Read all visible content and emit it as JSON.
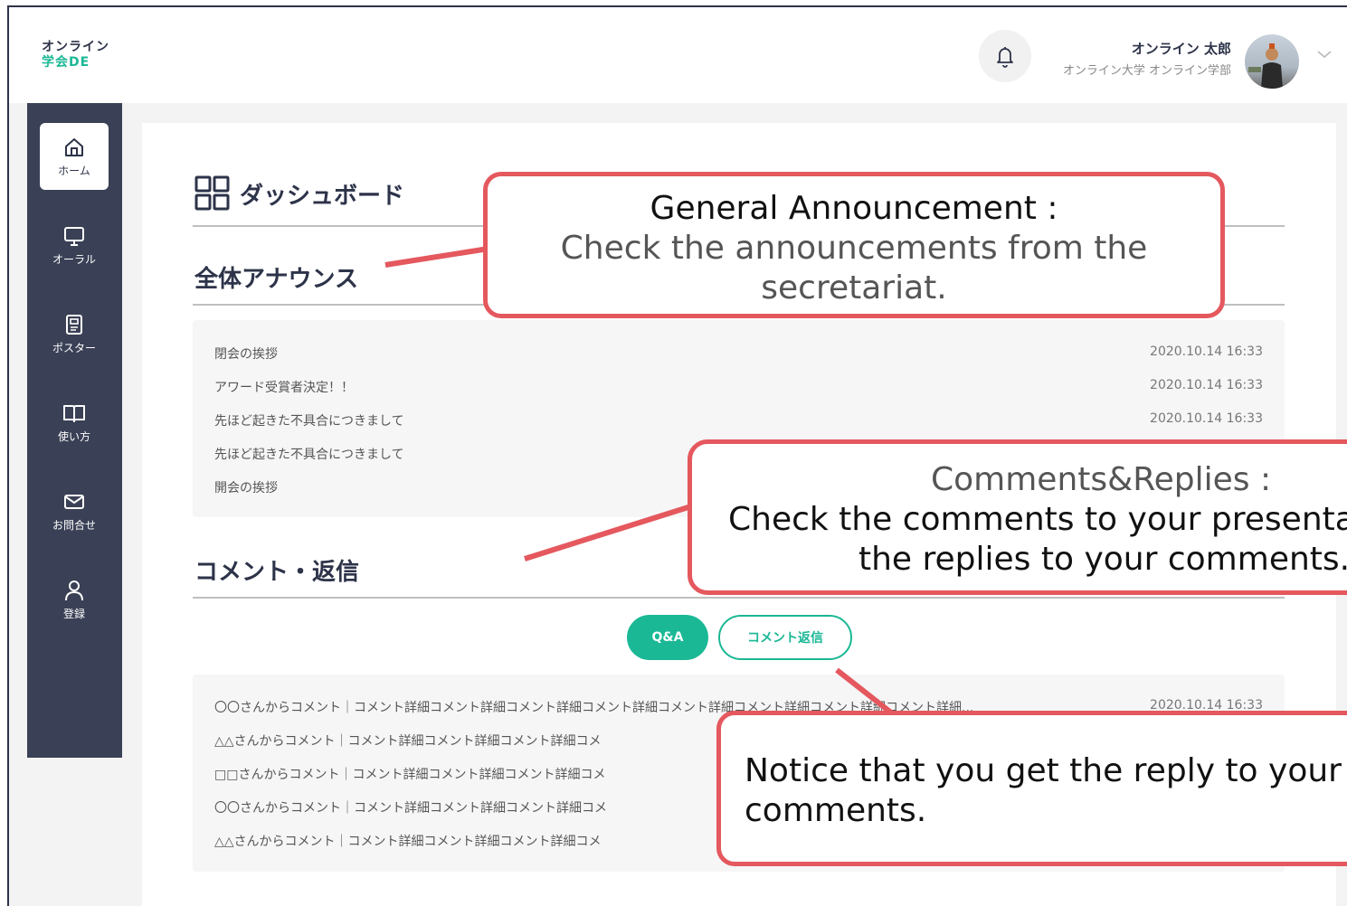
{
  "header": {
    "logo_line1": "オンライン",
    "logo_line2": "学会DE",
    "user_name": "オンライン 太郎",
    "user_org": "オンライン大学 オンライン学部"
  },
  "sidebar": {
    "items": [
      {
        "label": "ホーム",
        "icon": "home-icon",
        "active": true
      },
      {
        "label": "オーラル",
        "icon": "monitor-icon"
      },
      {
        "label": "ポスター",
        "icon": "poster-icon"
      },
      {
        "label": "使い方",
        "icon": "book-icon"
      },
      {
        "label": "お問合せ",
        "icon": "mail-icon"
      },
      {
        "label": "登録",
        "icon": "user-icon"
      }
    ]
  },
  "dashboard": {
    "title": "ダッシュボード",
    "announcements": {
      "title": "全体アナウンス",
      "rows": [
        {
          "text": "閉会の挨拶",
          "date": "2020.10.14 16:33"
        },
        {
          "text": "アワード受賞者決定！！",
          "date": "2020.10.14 16:33"
        },
        {
          "text": "先ほど起きた不具合につきまして",
          "date": "2020.10.14 16:33"
        },
        {
          "text": "先ほど起きた不具合につきまして",
          "date": ""
        },
        {
          "text": "開会の挨拶",
          "date": ""
        }
      ]
    },
    "comments": {
      "title": "コメント・返信",
      "tab_qa": "Q&A",
      "tab_reply": "コメント返信",
      "rows": [
        {
          "text": "〇〇さんからコメント｜コメント詳細コメント詳細コメント詳細コメント詳細コメント詳細コメント詳細コメント詳細コメント詳細...",
          "date": "2020.10.14 16:33"
        },
        {
          "text": "△△さんからコメント｜コメント詳細コメント詳細コメント詳細コメ",
          "date": ""
        },
        {
          "text": "□□さんからコメント｜コメント詳細コメント詳細コメント詳細コメ",
          "date": ""
        },
        {
          "text": "〇〇さんからコメント｜コメント詳細コメント詳細コメント詳細コメ",
          "date": ""
        },
        {
          "text": "△△さんからコメント｜コメント詳細コメント詳細コメント詳細コメ",
          "date": ""
        }
      ]
    }
  },
  "annotations": {
    "announcement": {
      "lead": "General Announcement :",
      "body": "Check the announcements from the secretariat."
    },
    "comments": {
      "lead": "Comments&Replies :",
      "body1": "Check the comments to your presentati",
      "body2": "the replies to your comments."
    },
    "reply": {
      "body": "Notice that you get the reply to your comments."
    }
  },
  "colors": {
    "accent": "#1bb895",
    "sidebar": "#3a4055",
    "callout_border": "#e4585e"
  }
}
